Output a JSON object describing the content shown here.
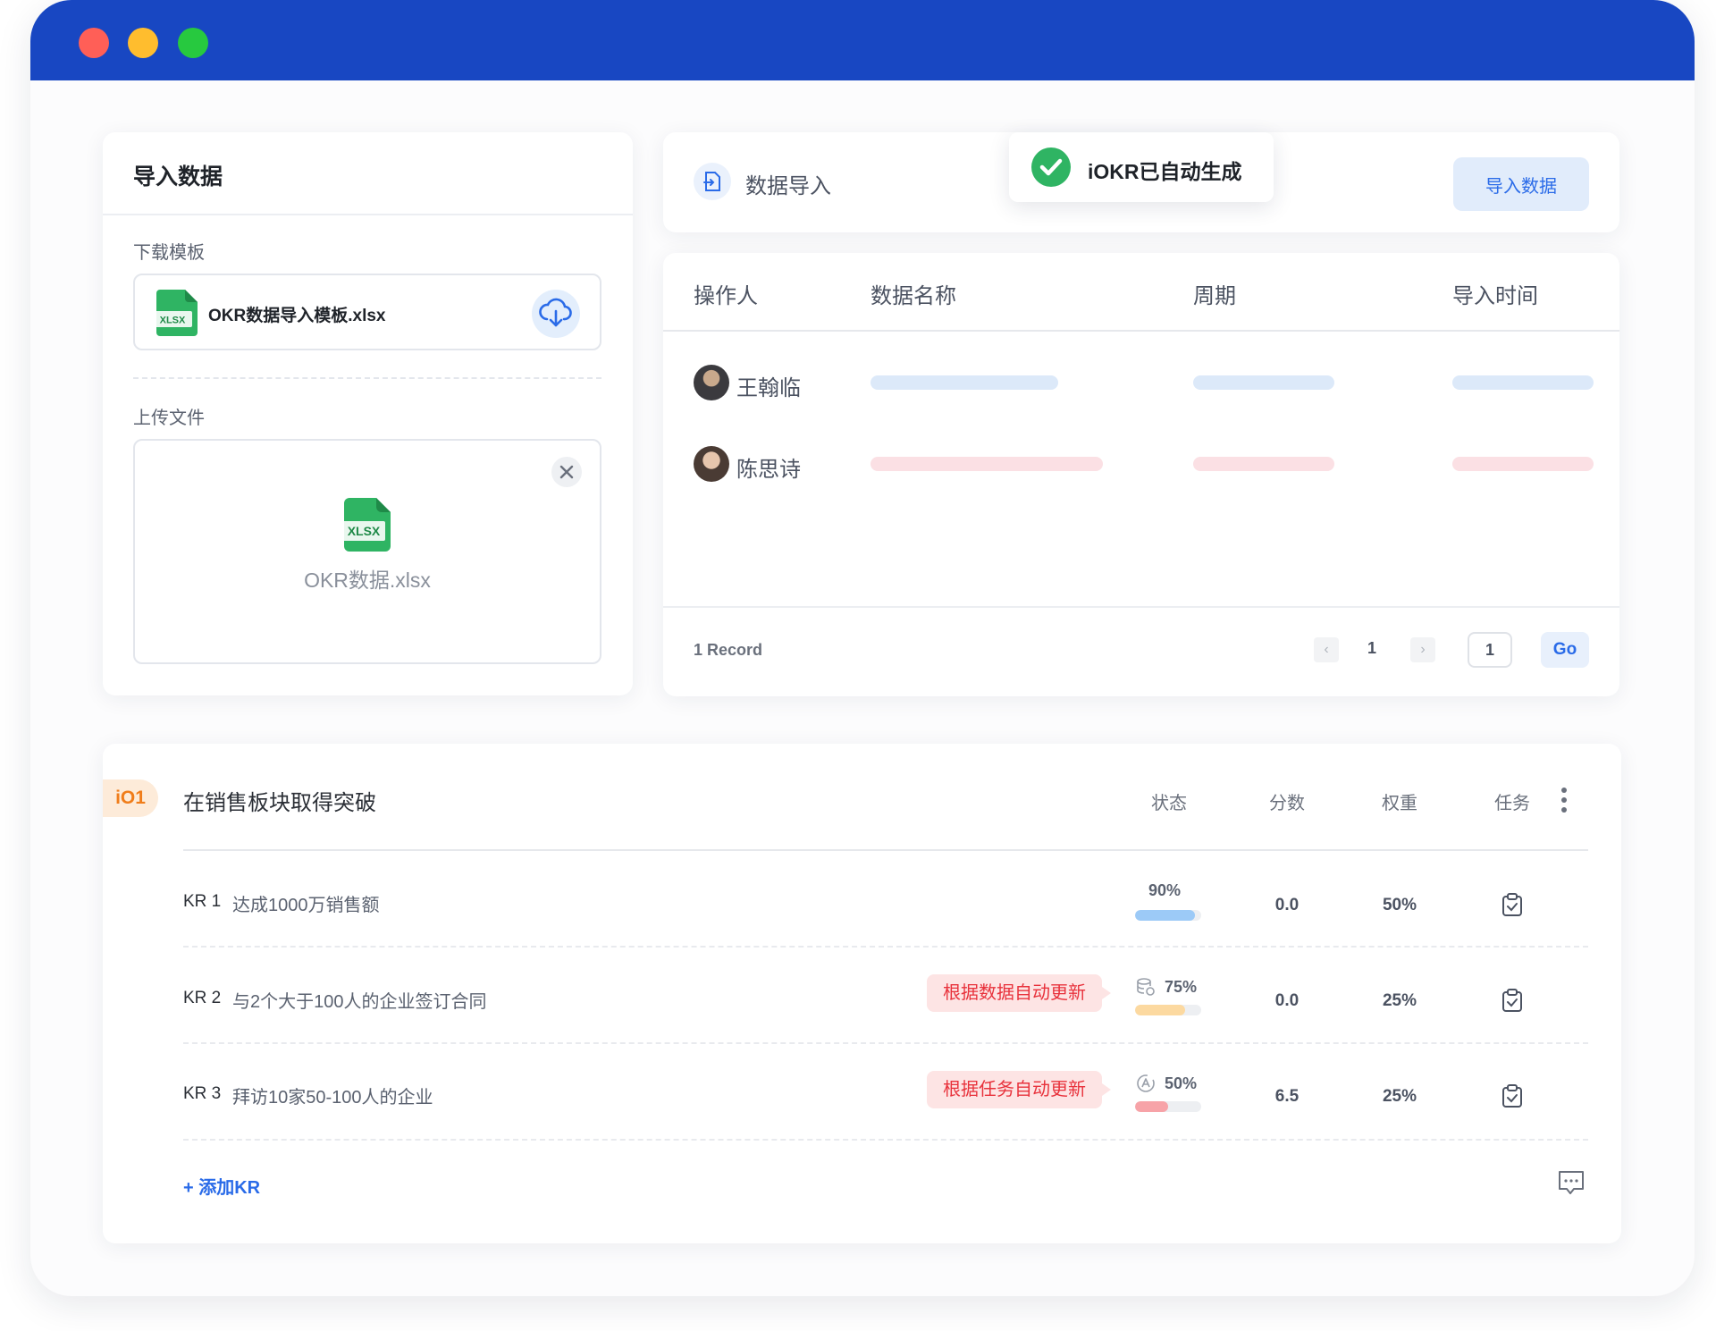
{
  "import_panel": {
    "title": "导入数据",
    "download_label": "下载模板",
    "template_file": "OKR数据导入模板.xlsx",
    "upload_label": "上传文件",
    "uploaded_file": "OKR数据.xlsx",
    "file_badge": "XLSX"
  },
  "data_import": {
    "title": "数据导入",
    "import_button": "导入数据"
  },
  "toast": {
    "text": "iOKR已自动生成"
  },
  "table": {
    "headers": [
      "操作人",
      "数据名称",
      "周期",
      "导入时间"
    ],
    "rows": [
      {
        "operator": "王翰临",
        "bar_color": "#dce9f9"
      },
      {
        "operator": "陈思诗",
        "bar_color": "#fbe0e4"
      }
    ],
    "record_count": "1 Record",
    "page": "1",
    "page_input": "1",
    "go_label": "Go"
  },
  "okr": {
    "objective_tag": "iO1",
    "objective_title": "在销售板块取得突破",
    "columns": [
      "状态",
      "分数",
      "权重",
      "任务"
    ],
    "key_results": [
      {
        "code": "KR 1",
        "text": "达成1000万销售额",
        "auto_tag": "",
        "progress": "90%",
        "progress_value": 0.9,
        "bar_color": "#9ccaf7",
        "score": "0.0",
        "weight": "50%"
      },
      {
        "code": "KR 2",
        "text": "与2个大于100人的企业签订合同",
        "auto_tag": "根据数据自动更新",
        "progress": "75%",
        "progress_value": 0.75,
        "bar_color": "#fcd9a0",
        "score": "0.0",
        "weight": "25%"
      },
      {
        "code": "KR 3",
        "text": "拜访10家50-100人的企业",
        "auto_tag": "根据任务自动更新",
        "progress": "50%",
        "progress_value": 0.5,
        "bar_color": "#f7a3a8",
        "score": "6.5",
        "weight": "25%"
      }
    ],
    "add_kr": "+ 添加KR"
  },
  "colors": {
    "titlebar": "#1847c2",
    "accent": "#2a6be8",
    "orange": "#f07d1a",
    "alert_red": "#e8323c"
  }
}
